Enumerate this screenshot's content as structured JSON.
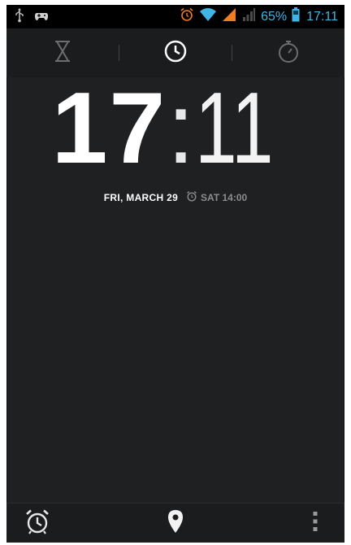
{
  "status_bar": {
    "battery_percent": "65%",
    "time": "17:11",
    "accent_color": "#3fb4e5",
    "icons": [
      "usb-icon",
      "game-controller-icon",
      "alarm-icon",
      "wifi-icon",
      "signal-orange-icon",
      "signal-gray-icon",
      "battery-icon"
    ]
  },
  "tabs": [
    {
      "id": "timer",
      "icon": "hourglass-icon",
      "selected": false
    },
    {
      "id": "clock",
      "icon": "clock-icon",
      "selected": true
    },
    {
      "id": "stopwatch",
      "icon": "stopwatch-icon",
      "selected": false
    }
  ],
  "clock": {
    "hours": "17",
    "separator": ":",
    "minutes": "11"
  },
  "date_line": {
    "date": "FRI, MARCH 29",
    "next_alarm": "SAT 14:00"
  },
  "bottom_bar": {
    "icons": [
      "alarm-icon",
      "location-pin-icon",
      "overflow-menu-icon"
    ]
  }
}
